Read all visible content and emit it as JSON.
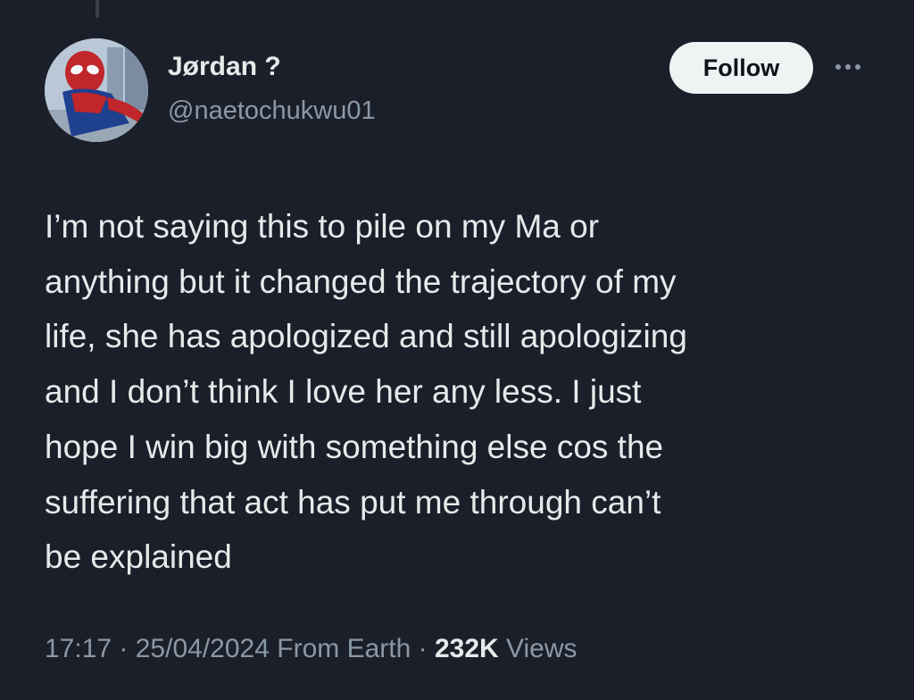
{
  "author": {
    "display_name": "Jørdan ?",
    "handle": "@naetochukwu01",
    "avatar_icon": "spider-man-avatar"
  },
  "actions": {
    "follow_label": "Follow",
    "more_icon": "more-options-icon"
  },
  "tweet": {
    "text": "I’m not saying this to pile on my Ma or\nanything but it changed the trajectory of my\nlife, she has apologized and still apologizing\nand I don’t think I love her any less. I just\nhope I win big with something else cos the\nsuffering that act has put me through can’t\nbe explained"
  },
  "meta": {
    "time": "17:17",
    "separator": " · ",
    "date": "25/04/2024",
    "source": "From Earth",
    "views_count": "232K",
    "views_label": "Views"
  },
  "colors": {
    "background": "#1b1f29",
    "text_primary": "#e7e9ea",
    "text_secondary": "#8b98a5",
    "follow_bg": "#eff3f4"
  }
}
